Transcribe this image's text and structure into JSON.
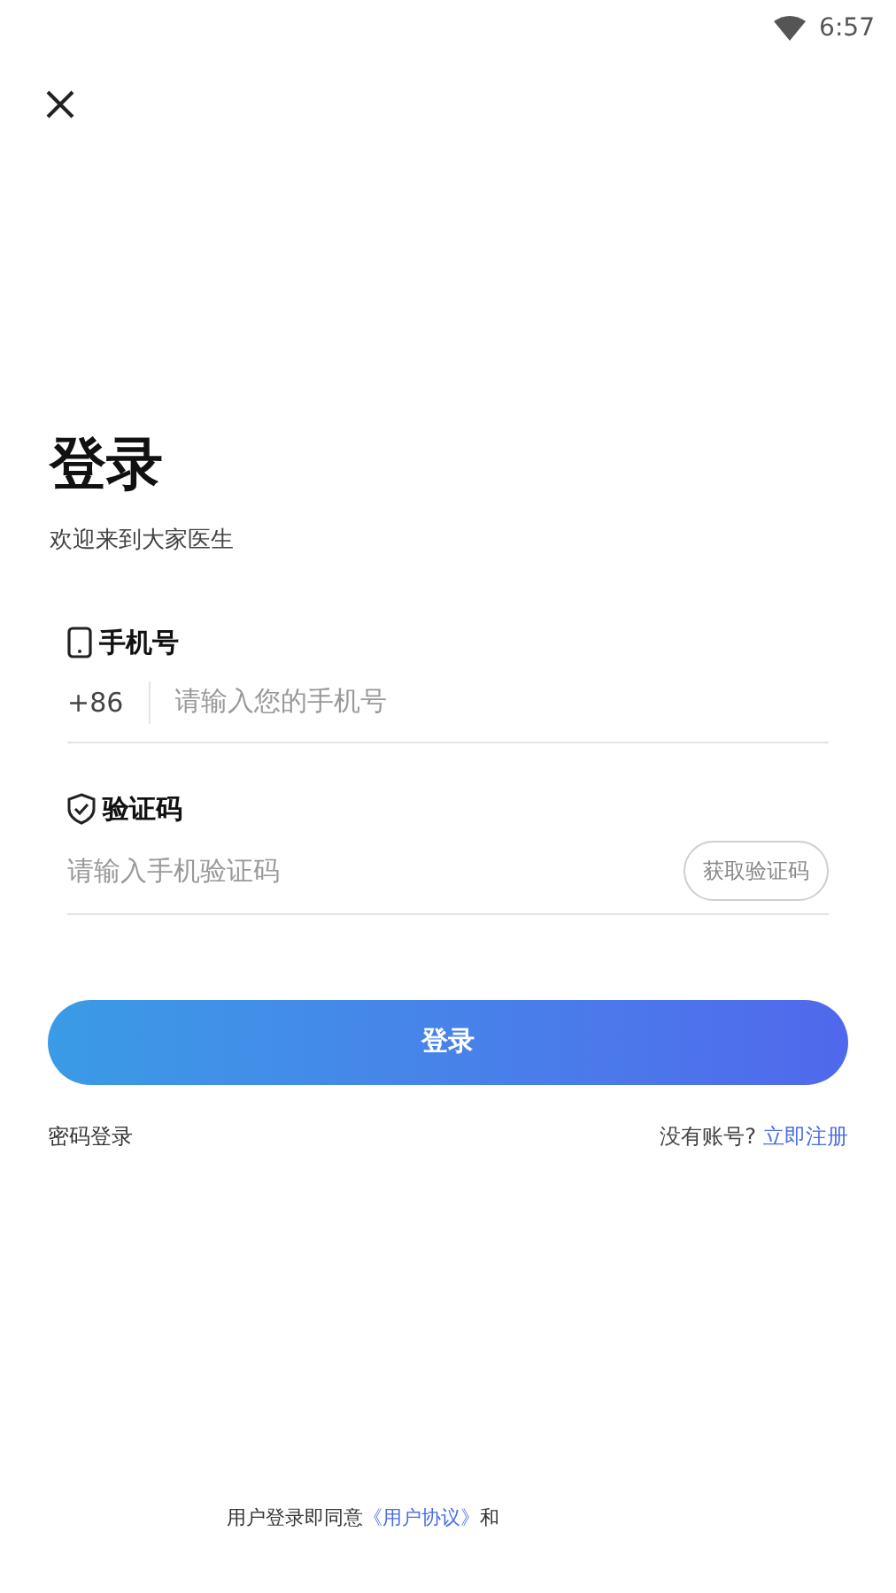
{
  "status_bar": {
    "time": "6:57"
  },
  "title": "登录",
  "subtitle": "欢迎来到大家医生",
  "phone": {
    "label": "手机号",
    "country_code": "+86",
    "placeholder": "请输入您的手机号"
  },
  "code": {
    "label": "验证码",
    "placeholder": "请输入手机验证码",
    "button": "获取验证码"
  },
  "login_button": "登录",
  "password_login": "密码登录",
  "register": {
    "prompt": "没有账号?",
    "link": "立即注册"
  },
  "agreement": {
    "text": "用户登录即同意",
    "link": "《用户协议》",
    "after": "和"
  }
}
